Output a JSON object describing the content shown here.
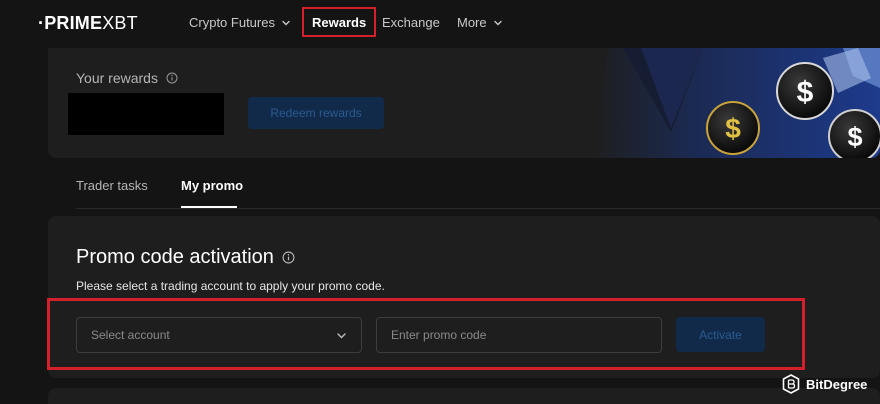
{
  "nav": {
    "logo_bold": "·PRIME",
    "logo_light": " XBT",
    "items": [
      {
        "label": "Crypto Futures",
        "has_dropdown": true
      },
      {
        "label": "Rewards",
        "active": true
      },
      {
        "label": "Exchange"
      },
      {
        "label": "More",
        "has_dropdown": true
      }
    ]
  },
  "hero": {
    "title": "Your rewards",
    "redeem_label": "Redeem rewards",
    "coin_symbol": "$"
  },
  "tabs": [
    {
      "label": "Trader tasks",
      "active": false
    },
    {
      "label": "My promo",
      "active": true
    }
  ],
  "promo": {
    "title": "Promo code activation",
    "subtitle": "Please select a trading account to apply your promo code.",
    "select_placeholder": "Select account",
    "input_placeholder": "Enter promo code",
    "activate_label": "Activate"
  },
  "watermark": {
    "label": "BitDegree"
  },
  "colors": {
    "background": "#141414",
    "card": "#1e1e1e",
    "highlight": "#d4202b",
    "button_bg": "#112a4a",
    "button_text": "#2a5a92"
  }
}
